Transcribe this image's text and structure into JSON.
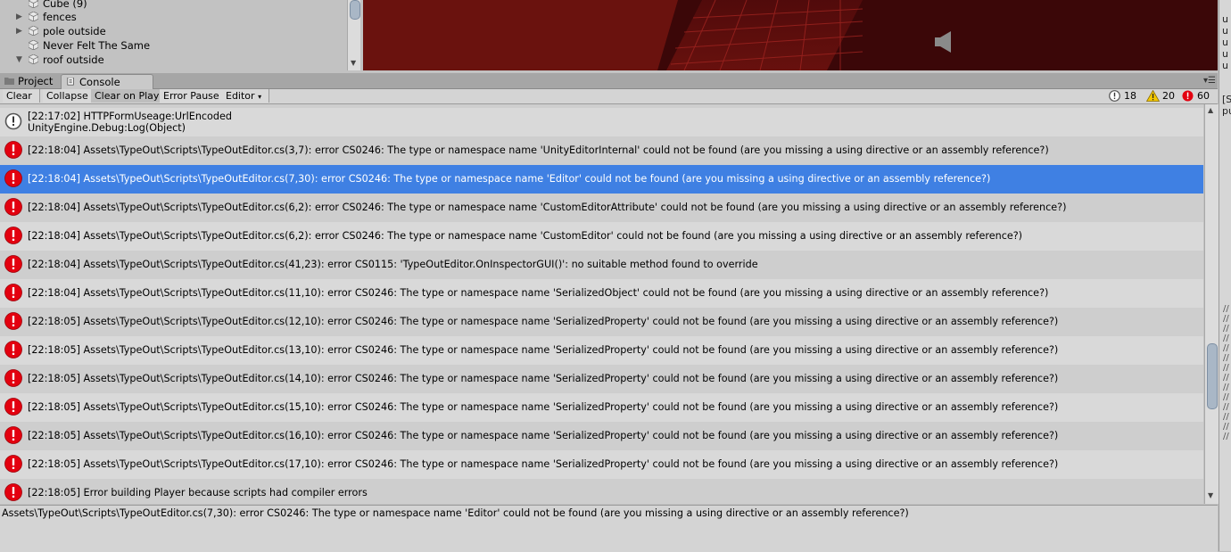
{
  "hierarchy": {
    "items": [
      {
        "label": "Cube (9)",
        "arrow": ""
      },
      {
        "label": "fences",
        "arrow": "▶"
      },
      {
        "label": "pole outside",
        "arrow": "▶"
      },
      {
        "label": "Never Felt The Same",
        "arrow": ""
      },
      {
        "label": "roof outside",
        "arrow": "▼"
      }
    ]
  },
  "tabs": {
    "project": "Project",
    "console": "Console"
  },
  "toolbar": {
    "clear": "Clear",
    "collapse": "Collapse",
    "clear_on_play": "Clear on Play",
    "error_pause": "Error Pause",
    "editor": "Editor"
  },
  "counts": {
    "log": "18",
    "warning": "20",
    "error": "60"
  },
  "logs": [
    {
      "type": "info",
      "line1": "[22:17:02] HTTPFormUseage:UrlEncoded",
      "line2": "UnityEngine.Debug:Log(Object)"
    },
    {
      "type": "error",
      "line1": "[22:18:04] Assets\\TypeOut\\Scripts\\TypeOutEditor.cs(3,7): error CS0246: The type or namespace name 'UnityEditorInternal' could not be found (are you missing a using directive or an assembly reference?)",
      "line2": ""
    },
    {
      "type": "error",
      "selected": true,
      "line1": "[22:18:04] Assets\\TypeOut\\Scripts\\TypeOutEditor.cs(7,30): error CS0246: The type or namespace name 'Editor' could not be found (are you missing a using directive or an assembly reference?)",
      "line2": ""
    },
    {
      "type": "error",
      "line1": "[22:18:04] Assets\\TypeOut\\Scripts\\TypeOutEditor.cs(6,2): error CS0246: The type or namespace name 'CustomEditorAttribute' could not be found (are you missing a using directive or an assembly reference?)",
      "line2": ""
    },
    {
      "type": "error",
      "line1": "[22:18:04] Assets\\TypeOut\\Scripts\\TypeOutEditor.cs(6,2): error CS0246: The type or namespace name 'CustomEditor' could not be found (are you missing a using directive or an assembly reference?)",
      "line2": ""
    },
    {
      "type": "error",
      "line1": "[22:18:04] Assets\\TypeOut\\Scripts\\TypeOutEditor.cs(41,23): error CS0115: 'TypeOutEditor.OnInspectorGUI()': no suitable method found to override",
      "line2": ""
    },
    {
      "type": "error",
      "line1": "[22:18:04] Assets\\TypeOut\\Scripts\\TypeOutEditor.cs(11,10): error CS0246: The type or namespace name 'SerializedObject' could not be found (are you missing a using directive or an assembly reference?)",
      "line2": ""
    },
    {
      "type": "error",
      "line1": "[22:18:05] Assets\\TypeOut\\Scripts\\TypeOutEditor.cs(12,10): error CS0246: The type or namespace name 'SerializedProperty' could not be found (are you missing a using directive or an assembly reference?)",
      "line2": ""
    },
    {
      "type": "error",
      "line1": "[22:18:05] Assets\\TypeOut\\Scripts\\TypeOutEditor.cs(13,10): error CS0246: The type or namespace name 'SerializedProperty' could not be found (are you missing a using directive or an assembly reference?)",
      "line2": ""
    },
    {
      "type": "error",
      "line1": "[22:18:05] Assets\\TypeOut\\Scripts\\TypeOutEditor.cs(14,10): error CS0246: The type or namespace name 'SerializedProperty' could not be found (are you missing a using directive or an assembly reference?)",
      "line2": ""
    },
    {
      "type": "error",
      "line1": "[22:18:05] Assets\\TypeOut\\Scripts\\TypeOutEditor.cs(15,10): error CS0246: The type or namespace name 'SerializedProperty' could not be found (are you missing a using directive or an assembly reference?)",
      "line2": ""
    },
    {
      "type": "error",
      "line1": "[22:18:05] Assets\\TypeOut\\Scripts\\TypeOutEditor.cs(16,10): error CS0246: The type or namespace name 'SerializedProperty' could not be found (are you missing a using directive or an assembly reference?)",
      "line2": ""
    },
    {
      "type": "error",
      "line1": "[22:18:05] Assets\\TypeOut\\Scripts\\TypeOutEditor.cs(17,10): error CS0246: The type or namespace name 'SerializedProperty' could not be found (are you missing a using directive or an assembly reference?)",
      "line2": ""
    },
    {
      "type": "error",
      "line1": "[22:18:05] Error building Player because scripts had compiler errors",
      "line2": ""
    }
  ],
  "detail": {
    "text": "Assets\\TypeOut\\Scripts\\TypeOutEditor.cs(7,30): error CS0246: The type or namespace name 'Editor' could not be found (are you missing a using directive or an assembly reference?)"
  },
  "inspector": {
    "top_lines": [
      "u",
      "u",
      "u",
      "u",
      "u"
    ],
    "mid_lines": [
      "[S",
      "pu"
    ],
    "slashes": [
      "//",
      "//",
      "//",
      "//",
      "//",
      "//",
      "//",
      "//",
      "//",
      "//",
      "//",
      "//",
      "//",
      "//"
    ]
  },
  "colors": {
    "error": "#e3000f",
    "warning": "#f3c700",
    "selected": "#3f80e3",
    "scene_bg": "#3b0708"
  },
  "icons": {
    "info": "info-icon",
    "error": "error-icon",
    "warning": "warning-icon",
    "speaker": "speaker-icon",
    "cube": "cube-icon"
  }
}
